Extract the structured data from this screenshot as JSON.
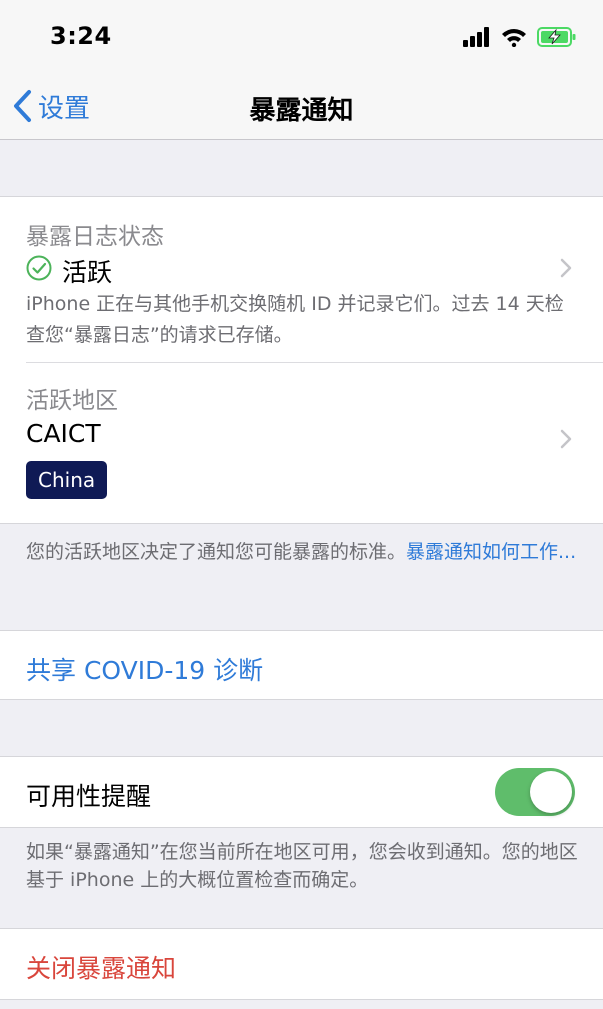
{
  "status_bar": {
    "time": "3:24"
  },
  "nav": {
    "back_label": "设置",
    "title": "暴露通知"
  },
  "exposure_log": {
    "label": "暴露日志状态",
    "status": "活跃",
    "description": "iPhone 正在与其他手机交换随机 ID 并记录它们。过去 14 天检查您“暴露日志”的请求已存储。"
  },
  "active_region": {
    "label": "活跃地区",
    "value": "CAICT",
    "badge": "China"
  },
  "region_note": {
    "text": "您的活跃地区决定了通知您可能暴露的标准。",
    "link": "暴露通知如何工作..."
  },
  "share": {
    "label": "共享 COVID-19 诊断"
  },
  "availability": {
    "label": "可用性提醒",
    "enabled": true,
    "note": "如果“暴露通知”在您当前所在地区可用，您会收到通知。您的地区基于 iPhone 上的大概位置检查而确定。"
  },
  "disable": {
    "label": "关闭暴露通知"
  },
  "colors": {
    "accent": "#2f7bd8",
    "toggle_on": "#5fbd6b",
    "destructive": "#d9463c",
    "status_active": "#4cb35a",
    "badge_bg": "#0f1a55",
    "battery": "#4cd964"
  }
}
